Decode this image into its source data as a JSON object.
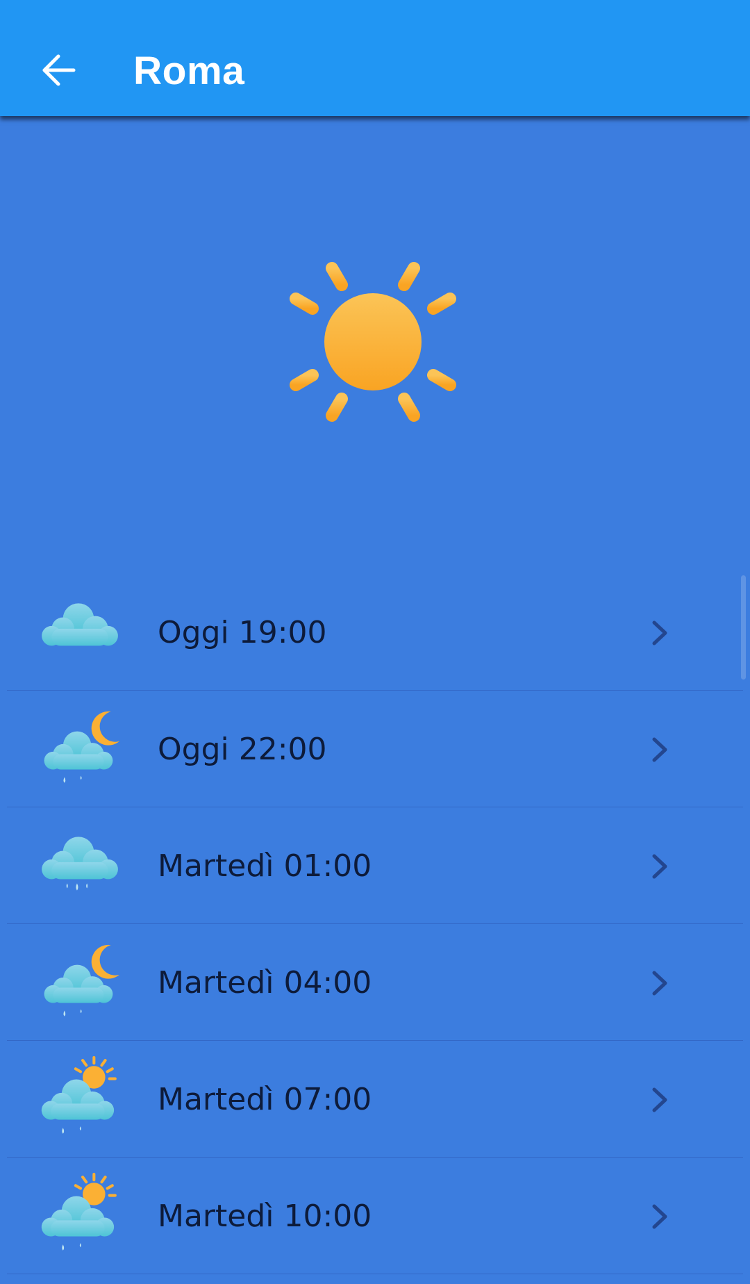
{
  "header": {
    "title": "Roma",
    "back_icon": "arrow-left-icon"
  },
  "current": {
    "icon": "sun-icon"
  },
  "forecast": [
    {
      "label": "Oggi 19:00",
      "icon": "cloud-icon"
    },
    {
      "label": "Oggi 22:00",
      "icon": "night-rain-icon"
    },
    {
      "label": "Martedì 01:00",
      "icon": "rain-icon"
    },
    {
      "label": "Martedì 04:00",
      "icon": "night-rain-icon"
    },
    {
      "label": "Martedì 07:00",
      "icon": "sun-rain-icon"
    },
    {
      "label": "Martedì 10:00",
      "icon": "sun-rain-icon"
    }
  ],
  "colors": {
    "app_bar": "#2196f3",
    "background": "#3c7ddf",
    "sun": "#fbb034",
    "cloud": "#5cc8dc"
  }
}
